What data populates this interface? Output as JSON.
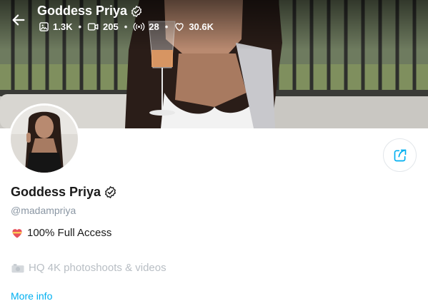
{
  "header": {
    "title": "Goddess Priya",
    "stats": {
      "photos": "1.3K",
      "videos": "205",
      "streams": "28",
      "likes": "30.6K"
    }
  },
  "profile": {
    "name": "Goddess Priya",
    "handle": "@madampriya",
    "bio": [
      "100% Full Access",
      "HQ 4K photoshoots & videos"
    ],
    "more_info_label": "More info"
  },
  "icons": {
    "back": "arrow-left-icon",
    "verified": "verified-badge-icon",
    "photos": "image-icon",
    "videos": "video-icon",
    "streams": "broadcast-icon",
    "likes": "heart-icon",
    "share": "share-icon",
    "bio_heart": "heart-emoji-icon",
    "bio_camera": "camera-emoji-icon"
  },
  "colors": {
    "accent": "#00aff0",
    "muted": "#8a96a3"
  }
}
